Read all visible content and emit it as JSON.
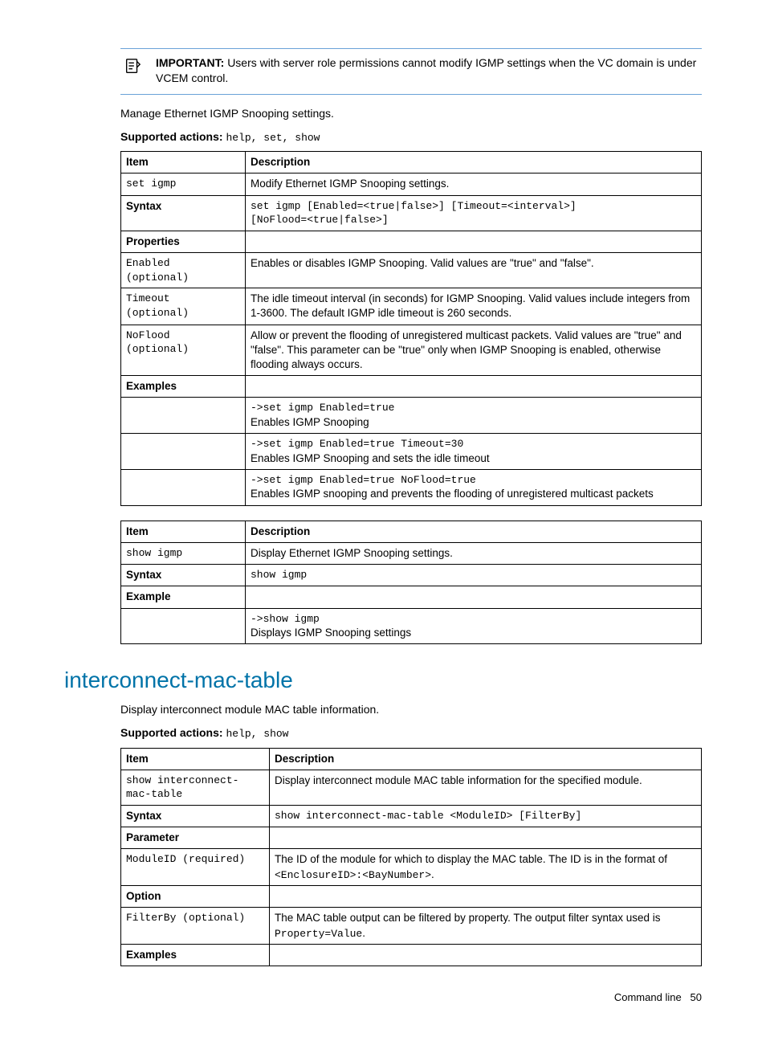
{
  "important": {
    "label": "IMPORTANT:",
    "text": "Users with server role permissions cannot modify IGMP settings when the VC domain is under VCEM control."
  },
  "igmp_intro": "Manage Ethernet IGMP Snooping settings.",
  "igmp_supported_label": "Supported actions",
  "igmp_supported_actions": "help, set, show",
  "table1": {
    "headers": {
      "c1": "Item",
      "c2": "Description"
    },
    "r1": {
      "c1": "set igmp",
      "c2": "Modify Ethernet IGMP Snooping settings."
    },
    "r2": {
      "c1": "Syntax",
      "c2a": "set igmp [Enabled=<true|false>] [Timeout=<interval>]",
      "c2b": "[NoFlood=<true|false>]"
    },
    "r3": {
      "c1": "Properties"
    },
    "r4": {
      "c1a": "Enabled",
      "c1b": "(optional)",
      "c2": "Enables or disables IGMP Snooping. Valid values are \"true\" and \"false\"."
    },
    "r5": {
      "c1a": "Timeout",
      "c1b": "(optional)",
      "c2": "The idle timeout interval (in seconds) for IGMP Snooping. Valid values include integers from 1-3600. The default IGMP idle timeout is 260 seconds."
    },
    "r6": {
      "c1a": "NoFlood",
      "c1b": "(optional)",
      "c2": "Allow or prevent the flooding of unregistered multicast packets. Valid values are \"true\" and \"false\". This parameter can be \"true\" only when IGMP Snooping is enabled, otherwise flooding always occurs."
    },
    "r7": {
      "c1": "Examples"
    },
    "r8": {
      "c2a": "->set igmp Enabled=true",
      "c2b": "Enables IGMP Snooping"
    },
    "r9": {
      "c2a": "->set igmp Enabled=true Timeout=30",
      "c2b": "Enables IGMP Snooping and sets the idle timeout"
    },
    "r10": {
      "c2a": "->set igmp Enabled=true NoFlood=true",
      "c2b": "Enables IGMP snooping and prevents the flooding of unregistered multicast packets"
    }
  },
  "table2": {
    "headers": {
      "c1": "Item",
      "c2": "Description"
    },
    "r1": {
      "c1": "show igmp",
      "c2": "Display Ethernet IGMP Snooping settings."
    },
    "r2": {
      "c1": "Syntax",
      "c2": "show igmp"
    },
    "r3": {
      "c1": "Example"
    },
    "r4": {
      "c2a": "->show igmp",
      "c2b": "Displays IGMP Snooping settings"
    }
  },
  "section2": {
    "title": "interconnect-mac-table",
    "intro": "Display interconnect module MAC table information.",
    "supported_label": "Supported actions",
    "supported_actions": "help, show"
  },
  "table3": {
    "headers": {
      "c1": "Item",
      "c2": "Description"
    },
    "r1": {
      "c1a": "show interconnect-",
      "c1b": "mac-table",
      "c2": "Display interconnect module MAC table information for the specified module."
    },
    "r2": {
      "c1": "Syntax",
      "c2": "show interconnect-mac-table <ModuleID> [FilterBy]"
    },
    "r3": {
      "c1": "Parameter"
    },
    "r4": {
      "c1": "ModuleID (required)",
      "c2_a": "The ID of the module for which to display the MAC table. The ID is in the format of ",
      "c2_b": "<EnclosureID>:<BayNumber>",
      "c2_c": "."
    },
    "r5": {
      "c1": "Option"
    },
    "r6": {
      "c1": "FilterBy (optional)",
      "c2_a": "The MAC table output can be filtered by property. The output filter syntax used is ",
      "c2_b": "Property=Value",
      "c2_c": "."
    },
    "r7": {
      "c1": "Examples"
    }
  },
  "footer": {
    "label": "Command line",
    "page": "50"
  }
}
